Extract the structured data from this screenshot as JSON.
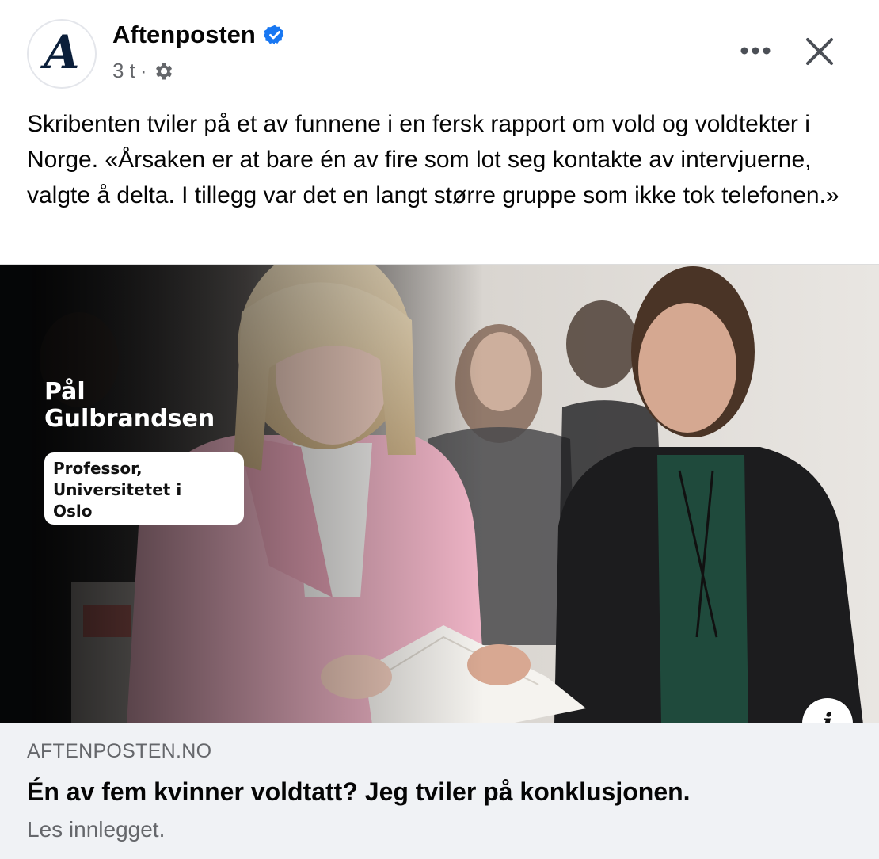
{
  "post": {
    "page_name": "Aftenposten",
    "avatar_glyph": "A",
    "time": "3 t",
    "separator": "·",
    "text": "Skribenten tviler på et av funnene i en fersk rapport om vold og voldtekter i Norge. «Årsaken er at bare én av fire som lot seg kontakte av intervjuerne, valgte å delta. I tillegg var det en langt større gruppe som ikke tok telefonen.»"
  },
  "image_overlay": {
    "name_line1": "Pål",
    "name_line2": "Gulbrandsen",
    "title_line1": "Professor,",
    "title_line2": "Universitetet i",
    "title_line3": "Oslo"
  },
  "link_preview": {
    "domain": "AFTENPOSTEN.NO",
    "headline": "Én av fem kvinner voldtatt? Jeg tviler på konklusjonen.",
    "subtext": "Les innlegget."
  },
  "icons": {
    "verified": "verified-badge-icon",
    "audience": "gear-icon",
    "more": "more-horizontal-icon",
    "close": "close-icon",
    "info": "info-icon"
  },
  "colors": {
    "verified_blue": "#1877f2",
    "secondary_text": "#65676b",
    "preview_bg": "#f0f2f5",
    "brand_navy": "#0b1f3a",
    "blazer_pink": "#efb4c6"
  }
}
